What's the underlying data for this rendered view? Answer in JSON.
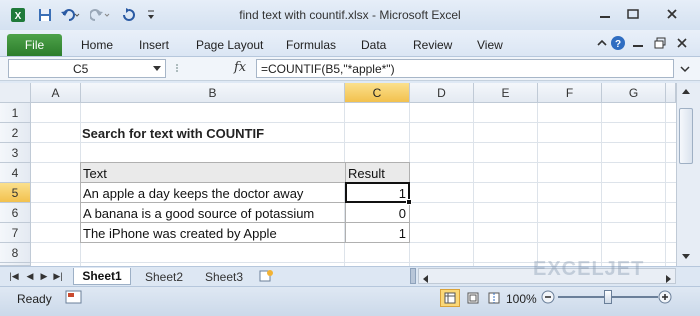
{
  "window": {
    "title": "find text with countif.xlsx  -  Microsoft Excel"
  },
  "ribbon": {
    "file_label": "File",
    "tabs": [
      "Home",
      "Insert",
      "Page Layout",
      "Formulas",
      "Data",
      "Review",
      "View"
    ]
  },
  "formula_bar": {
    "name_box": "C5",
    "fx_label": "fx",
    "formula": "=COUNTIF(B5,\"*apple*\")"
  },
  "grid": {
    "columns": [
      "A",
      "B",
      "C",
      "D",
      "E",
      "F",
      "G"
    ],
    "rows": [
      "1",
      "2",
      "3",
      "4",
      "5",
      "6",
      "7",
      "8",
      "9"
    ],
    "selected_column": "C",
    "selected_row": "5"
  },
  "sheet": {
    "title": "Search for text with COUNTIF",
    "table": {
      "headers": [
        "Text",
        "Result"
      ],
      "rows": [
        {
          "text": "An apple a day keeps the doctor away",
          "result": "1"
        },
        {
          "text": "A banana is a good source of potassium",
          "result": "0"
        },
        {
          "text": "The iPhone was created by Apple",
          "result": "1"
        }
      ]
    }
  },
  "sheet_tabs": [
    "Sheet1",
    "Sheet2",
    "Sheet3"
  ],
  "active_sheet": "Sheet1",
  "status": {
    "ready": "Ready",
    "zoom": "100%",
    "zoom_level": 1.0
  },
  "colors": {
    "selected_header": "#f2c14e",
    "file_tab": "#2c7d2b",
    "table_header_bg": "#eaeaea"
  },
  "watermark": "EXCELJET"
}
